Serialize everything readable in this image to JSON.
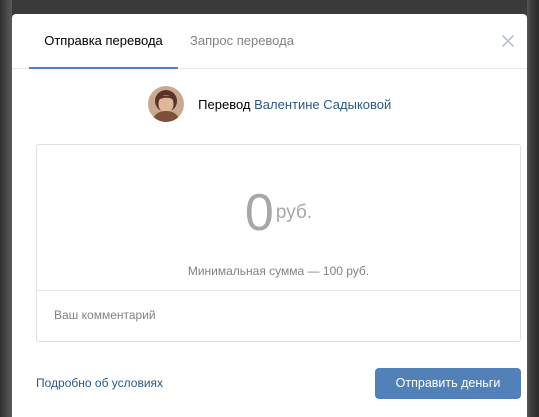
{
  "tabs": [
    {
      "label": "Отправка перевода",
      "active": true
    },
    {
      "label": "Запрос перевода",
      "active": false
    }
  ],
  "close_icon": "close-icon",
  "recipient": {
    "prefix": "Перевод",
    "name": "Валентине Садыковой",
    "avatar_icon": "user-avatar"
  },
  "amount": {
    "value": "0",
    "currency": "руб.",
    "hint": "Минимальная сумма — 100 руб."
  },
  "comment": {
    "placeholder": "Ваш комментарий"
  },
  "footer": {
    "details_link": "Подробно об условиях",
    "send_button": "Отправить деньги"
  },
  "colors": {
    "accent": "#5181b8",
    "link": "#2a5885",
    "muted": "#828282",
    "border": "#dce1e6"
  }
}
